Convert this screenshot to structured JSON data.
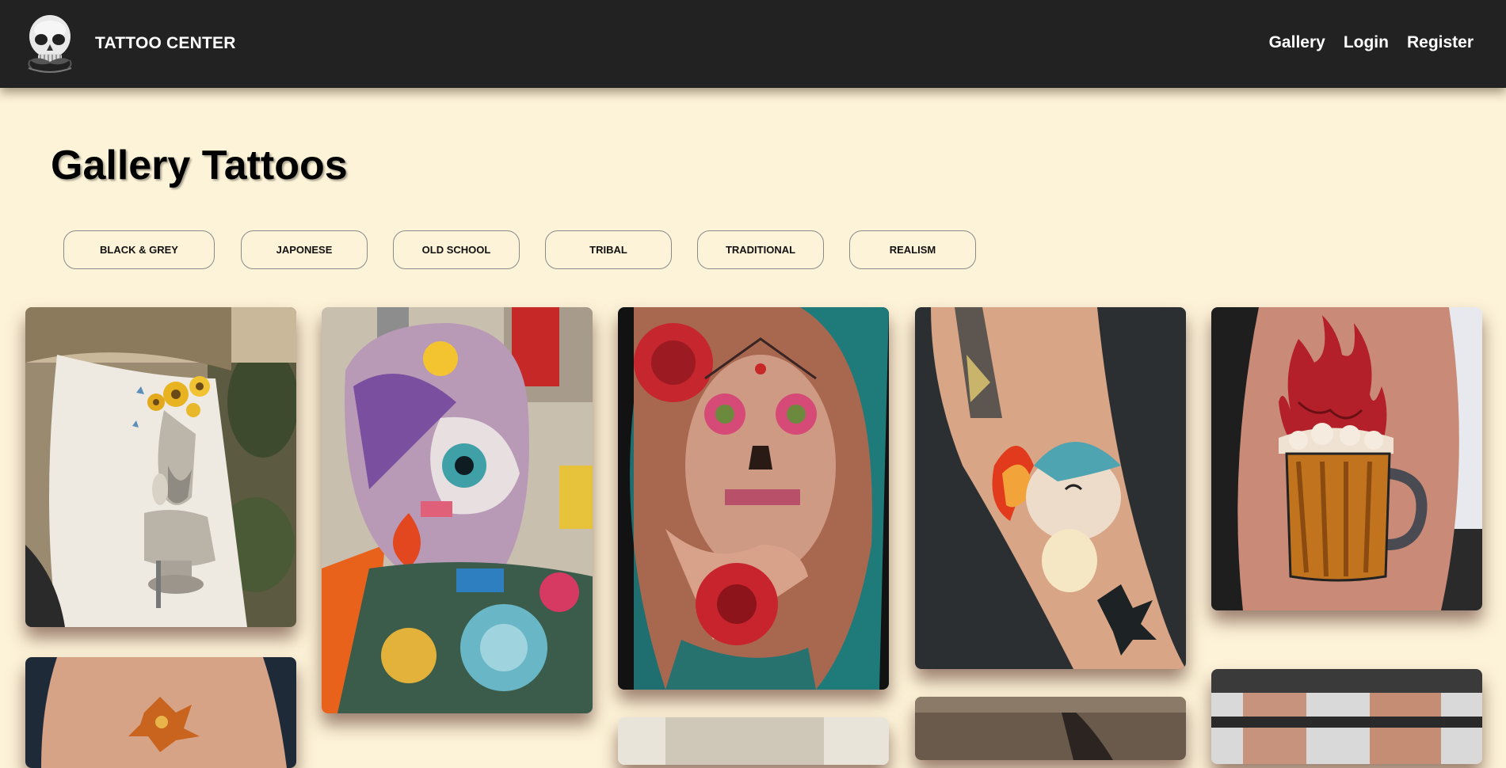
{
  "brand": {
    "name": "TATTOO CENTER",
    "logo_icon": "skull-logo-icon"
  },
  "nav": {
    "links": [
      {
        "label": "Gallery"
      },
      {
        "label": "Login"
      },
      {
        "label": "Register"
      }
    ]
  },
  "page": {
    "title": "Gallery Tattoos"
  },
  "filters": [
    {
      "label": "BLACK & GREY"
    },
    {
      "label": "JAPONESE"
    },
    {
      "label": "OLD SCHOOL"
    },
    {
      "label": "TRIBAL"
    },
    {
      "label": "TRADITIONAL"
    },
    {
      "label": "REALISM"
    }
  ],
  "colors": {
    "navbar_bg": "#222222",
    "page_bg": "#fdf3d8",
    "nav_text": "#ffffff"
  },
  "gallery": {
    "images": [
      {
        "subject": "van-gogh-sunflowers-tattoo"
      },
      {
        "subject": "colorful-head-eye-tattoo"
      },
      {
        "subject": "catrina-rose-tattoo"
      },
      {
        "subject": "cyndaquil-leg-tattoo"
      },
      {
        "subject": "flaming-beer-mug-tattoo"
      },
      {
        "subject": "ornament-tattoo"
      },
      {
        "subject": "partial-image"
      },
      {
        "subject": "partial-image"
      },
      {
        "subject": "partial-image"
      }
    ]
  }
}
